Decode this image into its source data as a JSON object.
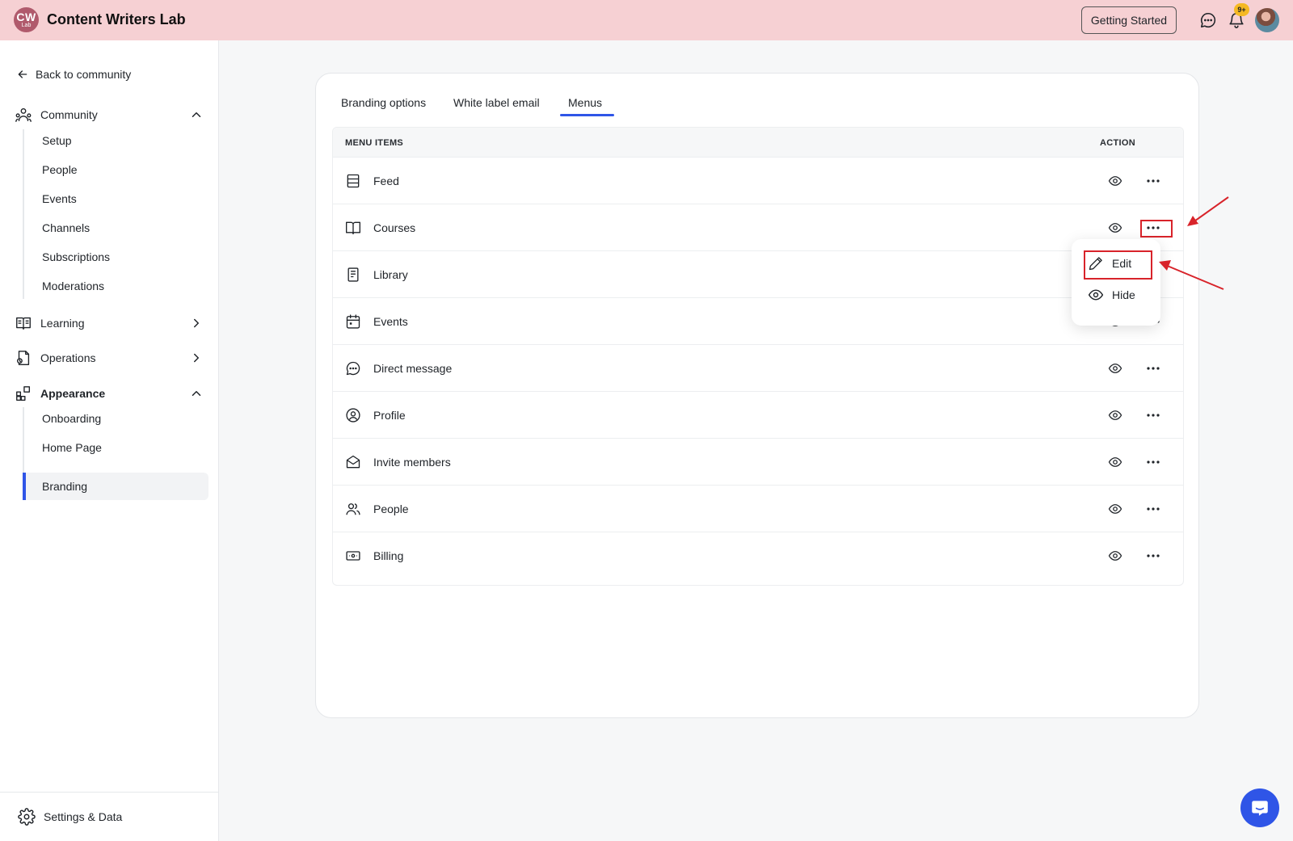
{
  "app": {
    "logo_top": "CW",
    "logo_bottom": "Lab",
    "title": "Content Writers Lab"
  },
  "topbar": {
    "getting_started": "Getting Started",
    "notification_badge": "9+",
    "icons": [
      "chat-icon",
      "bell-icon",
      "avatar"
    ]
  },
  "sidebar": {
    "back": "Back to community",
    "sections": [
      {
        "label": "Community",
        "icon": "community-icon",
        "expanded": true,
        "items": [
          "Setup",
          "People",
          "Events",
          "Channels",
          "Subscriptions",
          "Moderations"
        ]
      },
      {
        "label": "Learning",
        "icon": "book-icon",
        "expanded": false
      },
      {
        "label": "Operations",
        "icon": "operations-icon",
        "expanded": false
      },
      {
        "label": "Appearance",
        "icon": "appearance-icon",
        "expanded": true,
        "items": [
          "Onboarding",
          "Home Page",
          "Branding"
        ],
        "active_item": "Branding"
      }
    ],
    "settings": "Settings & Data"
  },
  "tabs": [
    {
      "label": "Branding options"
    },
    {
      "label": "White label email"
    },
    {
      "label": "Menus",
      "active": true
    }
  ],
  "table": {
    "col_items": "MENU ITEMS",
    "col_action": "ACTION",
    "rows": [
      {
        "label": "Feed",
        "icon": "feed-icon"
      },
      {
        "label": "Courses",
        "icon": "book-open-icon"
      },
      {
        "label": "Library",
        "icon": "library-icon"
      },
      {
        "label": "Events",
        "icon": "calendar-icon"
      },
      {
        "label": "Direct message",
        "icon": "message-icon"
      },
      {
        "label": "Profile",
        "icon": "profile-icon"
      },
      {
        "label": "Invite members",
        "icon": "envelope-icon"
      },
      {
        "label": "People",
        "icon": "people-icon"
      },
      {
        "label": "Billing",
        "icon": "billing-icon"
      }
    ]
  },
  "dropdown": {
    "edit": "Edit",
    "hide": "Hide"
  },
  "colors": {
    "topbar_bg": "#f6d0d3",
    "accent": "#2f55e7",
    "annotation": "#d8232a"
  }
}
